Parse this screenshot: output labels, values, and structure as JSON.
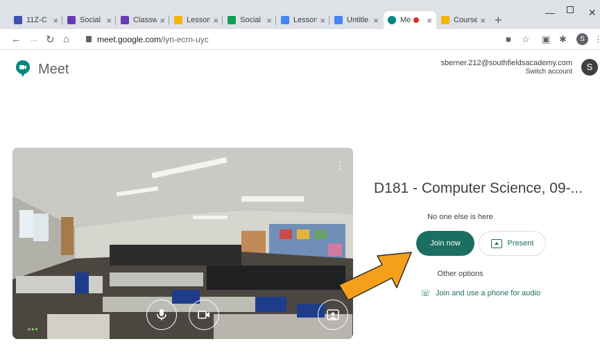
{
  "browser": {
    "tabs": [
      {
        "title": "11Z-C",
        "icon": "classroom-icon",
        "color": "#3f51b5"
      },
      {
        "title": "Social",
        "icon": "classroom-icon",
        "color": "#673ab7"
      },
      {
        "title": "Classw",
        "icon": "classroom-icon",
        "color": "#673ab7"
      },
      {
        "title": "Lesson",
        "icon": "slides-icon",
        "color": "#f4b400"
      },
      {
        "title": "Social",
        "icon": "sheets-icon",
        "color": "#0f9d58"
      },
      {
        "title": "Lesson",
        "icon": "drive-icon",
        "color": "#4285f4"
      },
      {
        "title": "Untitle",
        "icon": "docs-icon",
        "color": "#4285f4"
      },
      {
        "title": "Me",
        "icon": "meet-icon",
        "color": "#00897b",
        "active": true
      },
      {
        "title": "Course",
        "icon": "sites-icon",
        "color": "#f4b400"
      }
    ],
    "close_glyph": "×",
    "new_tab_glyph": "+",
    "url_domain": "meet.google.com",
    "url_path": "/iyn-ecrn-uyc",
    "profile_initial": "S"
  },
  "meet": {
    "title": "Meet",
    "account_email": "sberner.212@southfieldsacademy.com",
    "switch_account": "Switch account",
    "avatar_initial": "S",
    "meeting_name": "D181 - Computer Science, 09-...",
    "status": "No one else is here",
    "join_label": "Join now",
    "present_label": "Present",
    "other_options": "Other options",
    "phone_label": "Join and use a phone for audio",
    "accent_color": "#1b6f61"
  },
  "annotation": {
    "arrow_color": "#f5a01a"
  }
}
